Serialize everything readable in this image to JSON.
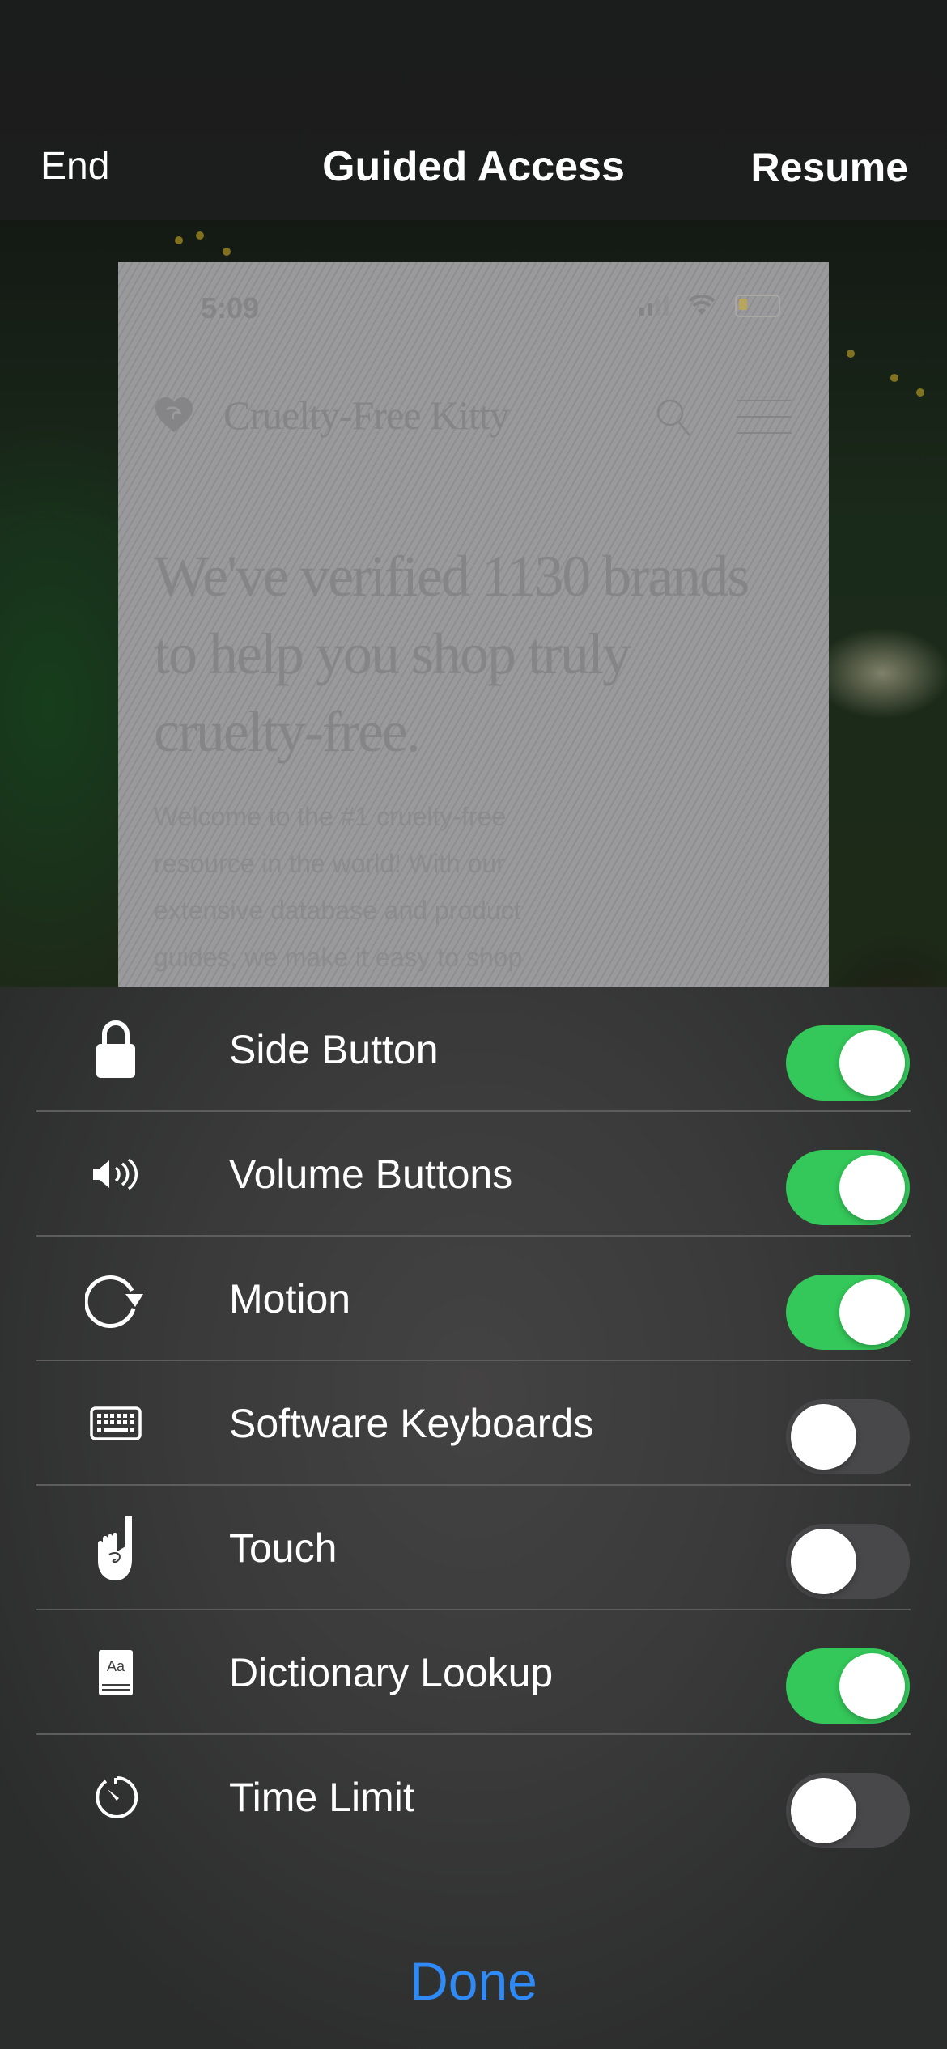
{
  "nav": {
    "end_label": "End",
    "title": "Guided Access",
    "resume_label": "Resume"
  },
  "preview": {
    "status_time": "5:09",
    "brand_name": "Cruelty-Free Kitty",
    "headline": "We've verified 1130 brands to help you shop truly cruelty-free.",
    "body": "Welcome to the #1 cruelty-free resource in the world! With our extensive database and product guides, we make it easy to shop"
  },
  "options": [
    {
      "label": "Side Button",
      "icon": "lock-icon",
      "enabled": true
    },
    {
      "label": "Volume Buttons",
      "icon": "speaker-icon",
      "enabled": true
    },
    {
      "label": "Motion",
      "icon": "rotate-icon",
      "enabled": true
    },
    {
      "label": "Software Keyboards",
      "icon": "keyboard-icon",
      "enabled": false
    },
    {
      "label": "Touch",
      "icon": "hand-pointing-icon",
      "enabled": false
    },
    {
      "label": "Dictionary Lookup",
      "icon": "dictionary-icon",
      "enabled": true
    },
    {
      "label": "Time Limit",
      "icon": "timer-icon",
      "enabled": false
    }
  ],
  "dictionary_icon_text": "Aa",
  "done_label": "Done",
  "colors": {
    "toggle_on": "#34c759",
    "toggle_off": "#48484a",
    "accent": "#2f8af5"
  }
}
